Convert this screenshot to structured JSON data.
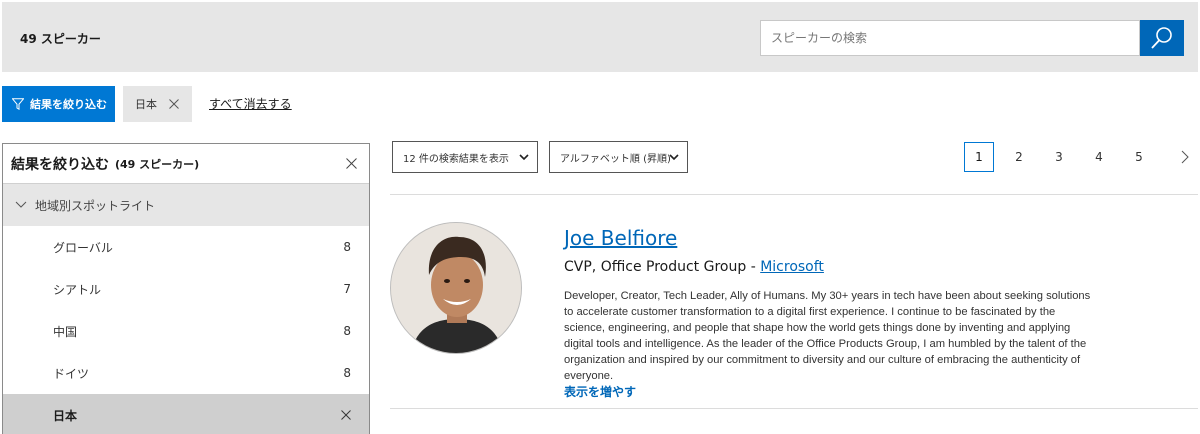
{
  "header": {
    "count_label": "49 スピーカー",
    "search_placeholder": "スピーカーの検索",
    "search_icon": "search-icon"
  },
  "filters": {
    "refine_label": "結果を絞り込む",
    "active_chip": "日本",
    "clear_all": "すべて消去する"
  },
  "sidebar": {
    "title": "結果を絞り込む",
    "subtitle": "(49 スピーカー)",
    "group_label": "地域別スポットライト",
    "items": [
      {
        "label": "グローバル",
        "count": "8"
      },
      {
        "label": "シアトル",
        "count": "7"
      },
      {
        "label": "中国",
        "count": "8"
      },
      {
        "label": "ドイツ",
        "count": "8"
      }
    ],
    "active_item": "日本"
  },
  "controls": {
    "results_per_page": "12 件の検索結果を表示",
    "sort_order": "アルファベット順 (昇順)"
  },
  "pagination": {
    "pages": [
      "1",
      "2",
      "3",
      "4",
      "5"
    ],
    "current": "1"
  },
  "speaker": {
    "name": "Joe Belfiore",
    "title": "CVP, Office Product Group - ",
    "company": "Microsoft",
    "bio": "Developer, Creator, Tech Leader, Ally of Humans. My 30+ years in tech have been about seeking solutions to accelerate customer transformation to a digital first experience. I continue to be fascinated by the science, engineering, and people that shape how the world gets things done by inventing and applying digital tools and intelligence. As the leader of the Office Products Group, I am humbled by the talent of the organization and inspired by our commitment to diversity and our culture of embracing the authenticity of everyone.",
    "show_more": "表示を増やす"
  },
  "colors": {
    "accent": "#0078d4",
    "link": "#0067b8",
    "header_bg": "#e6e6e6"
  }
}
